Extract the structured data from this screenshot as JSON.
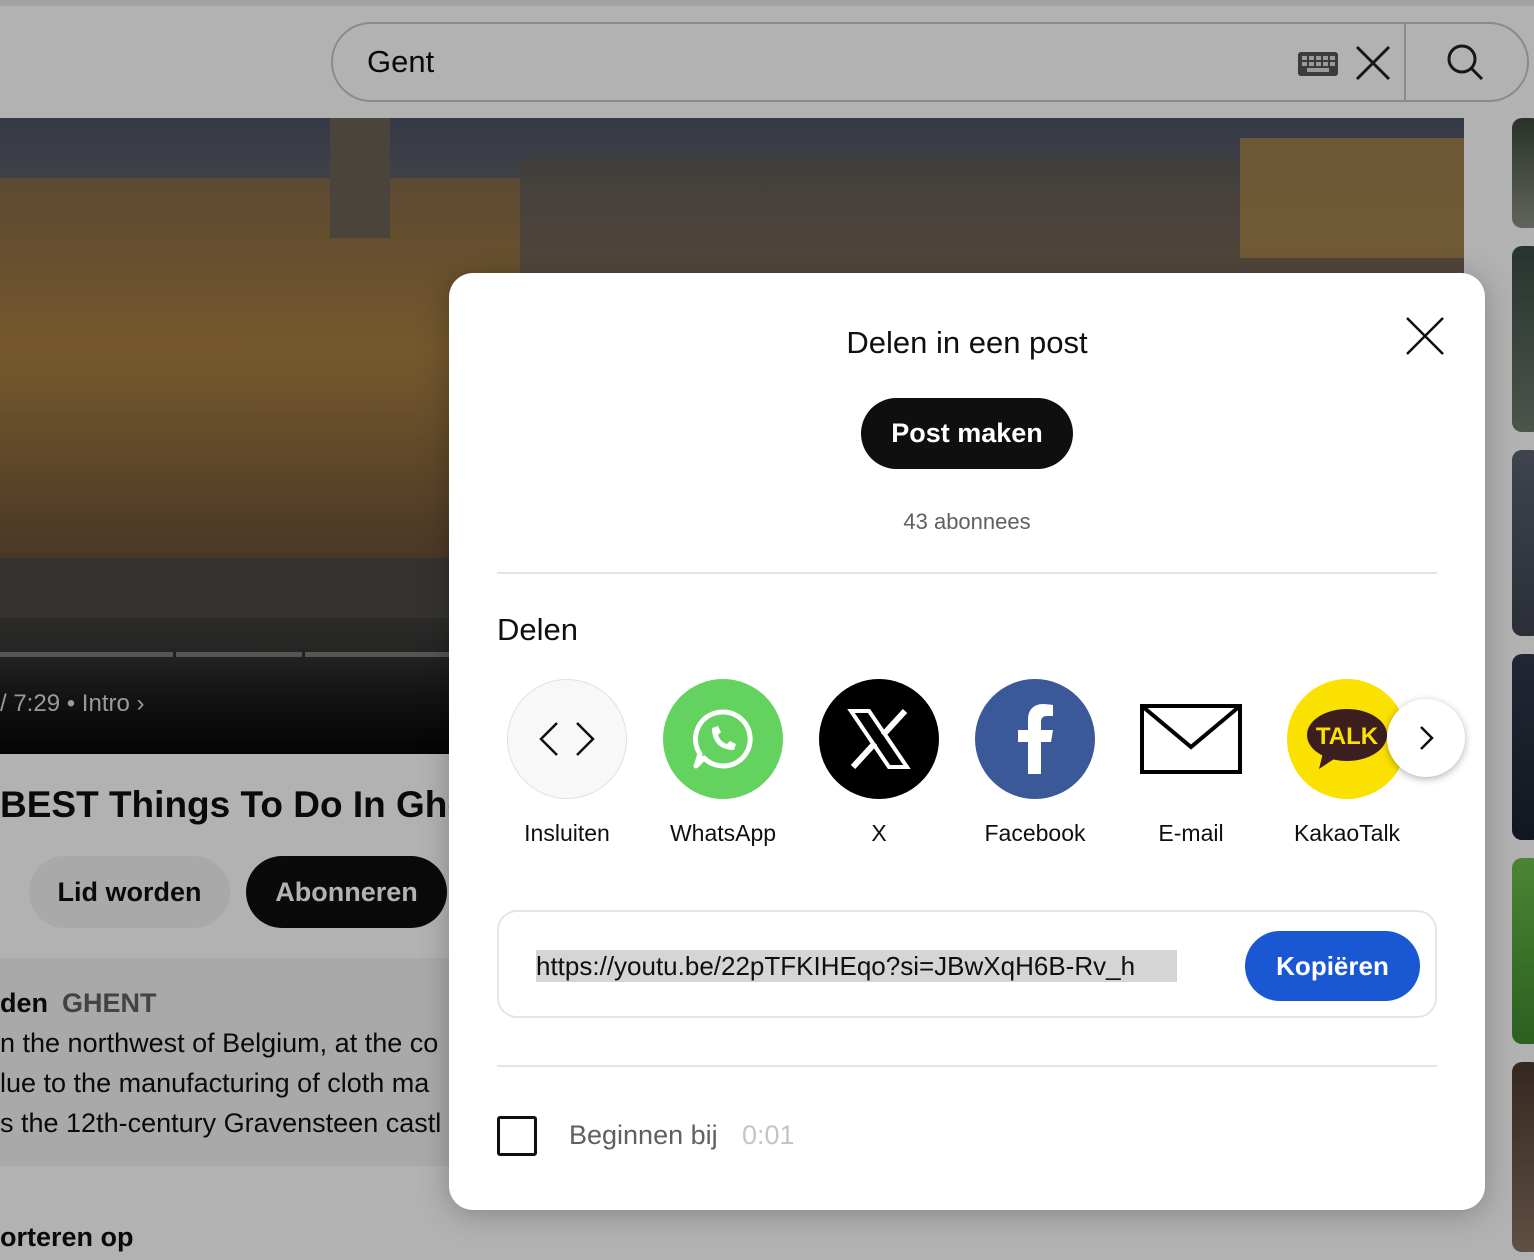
{
  "search": {
    "query": "Gent"
  },
  "video": {
    "time": "/ 7:29",
    "chapter": "Intro",
    "title": "BEST Things To Do In Ghe"
  },
  "channel_actions": {
    "join_label": "Lid worden",
    "subscribe_label": "Abonneren"
  },
  "description": {
    "meta_prefix": "den",
    "tag": "GHENT",
    "lines": [
      "n the northwest of Belgium, at the co",
      "lue to the manufacturing of cloth ma",
      "s the 12th-century Gravensteen castl"
    ]
  },
  "comments": {
    "sort_label": "orteren op"
  },
  "share_dialog": {
    "title": "Delen in een post",
    "post_button": "Post maken",
    "subscribers": "43 abonnees",
    "share_heading": "Delen",
    "targets": [
      {
        "label": "Insluiten",
        "icon": "embed-code-icon",
        "color": "#f8f8f8"
      },
      {
        "label": "WhatsApp",
        "icon": "whatsapp-icon",
        "color": "#63d25f"
      },
      {
        "label": "X",
        "icon": "x-logo-icon",
        "color": "#000000"
      },
      {
        "label": "Facebook",
        "icon": "facebook-icon",
        "color": "#3b5998"
      },
      {
        "label": "E-mail",
        "icon": "mail-icon",
        "color": "#ffffff"
      },
      {
        "label": "KakaoTalk",
        "icon": "kakaotalk-icon",
        "color": "#fae100",
        "badge": "TALK"
      }
    ],
    "link": "https://youtu.be/22pTFKIHEqo?si=JBwXqH6B-Rv_h",
    "copy_button": "Kopiëren",
    "start_at_label": "Beginnen bij",
    "start_at_time": "0:01"
  }
}
